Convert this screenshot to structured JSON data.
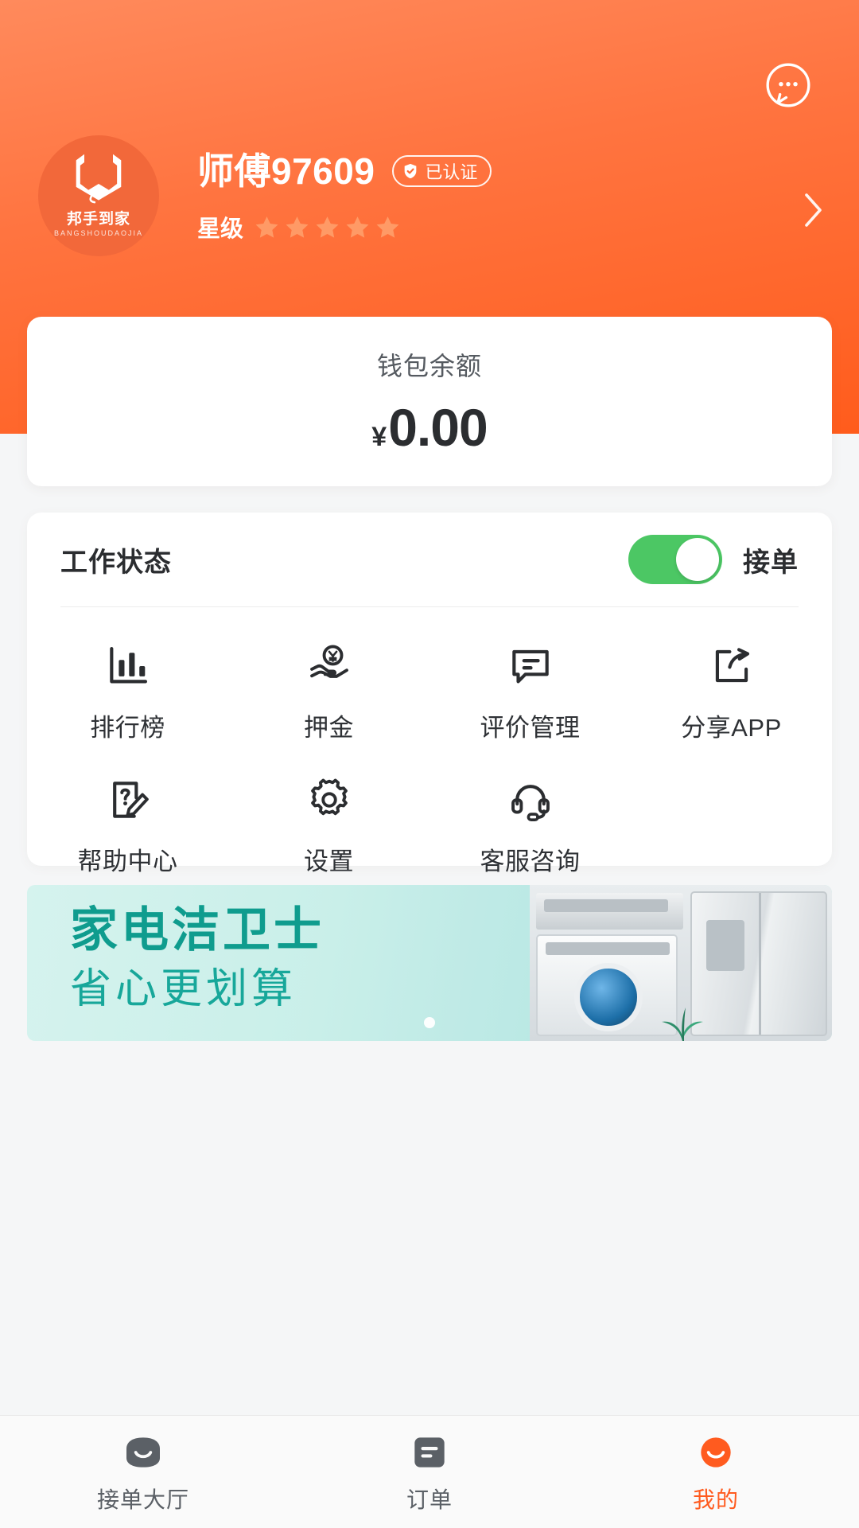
{
  "theme": {
    "brand_orange": "#FF5B1F",
    "header_gradient_from": "#FF8A5C",
    "header_gradient_to": "#FF5C1C",
    "toggle_green": "#4CC764",
    "banner_teal": "#0F9C8E",
    "active_tab_color": "#FF5B1F"
  },
  "header": {
    "chat_icon": "chat-bubble-icon",
    "avatar": {
      "icon": "brand-robot-mark-icon",
      "brand_text": "邦手到家",
      "brand_sub": "BANGSHOUDAOJIA"
    },
    "username": "师傅97609",
    "verified": {
      "icon": "shield-check-icon",
      "label": "已认证"
    },
    "rating": {
      "label": "星级",
      "stars_total": 5,
      "stars_filled": 5,
      "star_icon": "star-icon"
    },
    "chevron_icon": "chevron-right-icon"
  },
  "wallet": {
    "label": "钱包余额",
    "currency": "¥",
    "amount": "0.00"
  },
  "work_status": {
    "title": "工作状态",
    "toggle_on": true,
    "state_label": "接单"
  },
  "grid": {
    "items": [
      {
        "label": "排行榜",
        "icon": "bar-chart-icon"
      },
      {
        "label": "押金",
        "icon": "hand-coin-icon"
      },
      {
        "label": "评价管理",
        "icon": "comment-icon"
      },
      {
        "label": "分享APP",
        "icon": "share-export-icon"
      },
      {
        "label": "帮助中心",
        "icon": "help-document-icon"
      },
      {
        "label": "设置",
        "icon": "gear-icon"
      },
      {
        "label": "客服咨询",
        "icon": "headset-icon"
      }
    ]
  },
  "banner": {
    "line1": "家电洁卫士",
    "line2": "省心更划算",
    "image_alt": "appliance-photo"
  },
  "tabbar": {
    "tabs": [
      {
        "label": "接单大厅",
        "icon": "hall-icon",
        "active": false
      },
      {
        "label": "订单",
        "icon": "order-icon",
        "active": false
      },
      {
        "label": "我的",
        "icon": "profile-smiley-icon",
        "active": true
      }
    ]
  }
}
